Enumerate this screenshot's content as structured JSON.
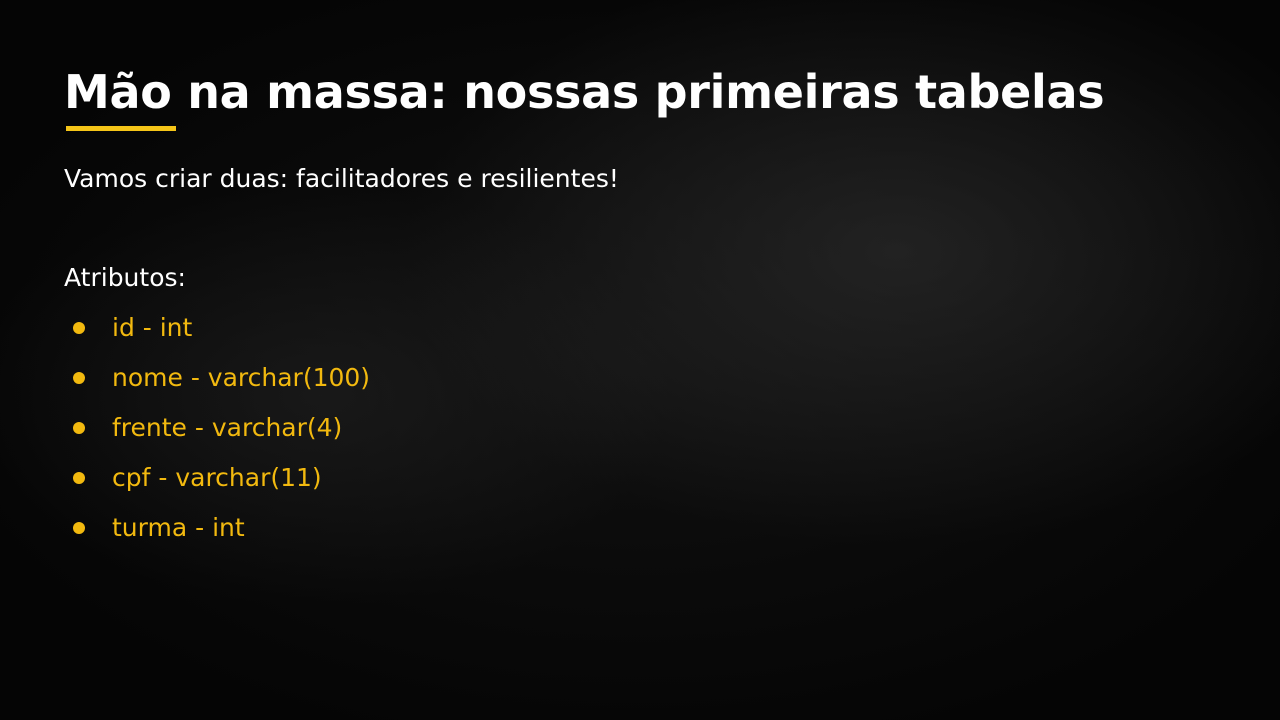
{
  "slide": {
    "title": "Mão na massa: nossas primeiras tabelas",
    "subtitle": "Vamos criar duas: facilitadores e resilientes!",
    "attributes_heading": "Atributos:",
    "attributes": [
      "id - int",
      "nome - varchar(100)",
      "frente - varchar(4)",
      "cpf - varchar(11)",
      "turma - int"
    ]
  },
  "colors": {
    "accent": "#f2b90f",
    "text": "#ffffff",
    "background": "#050505"
  }
}
